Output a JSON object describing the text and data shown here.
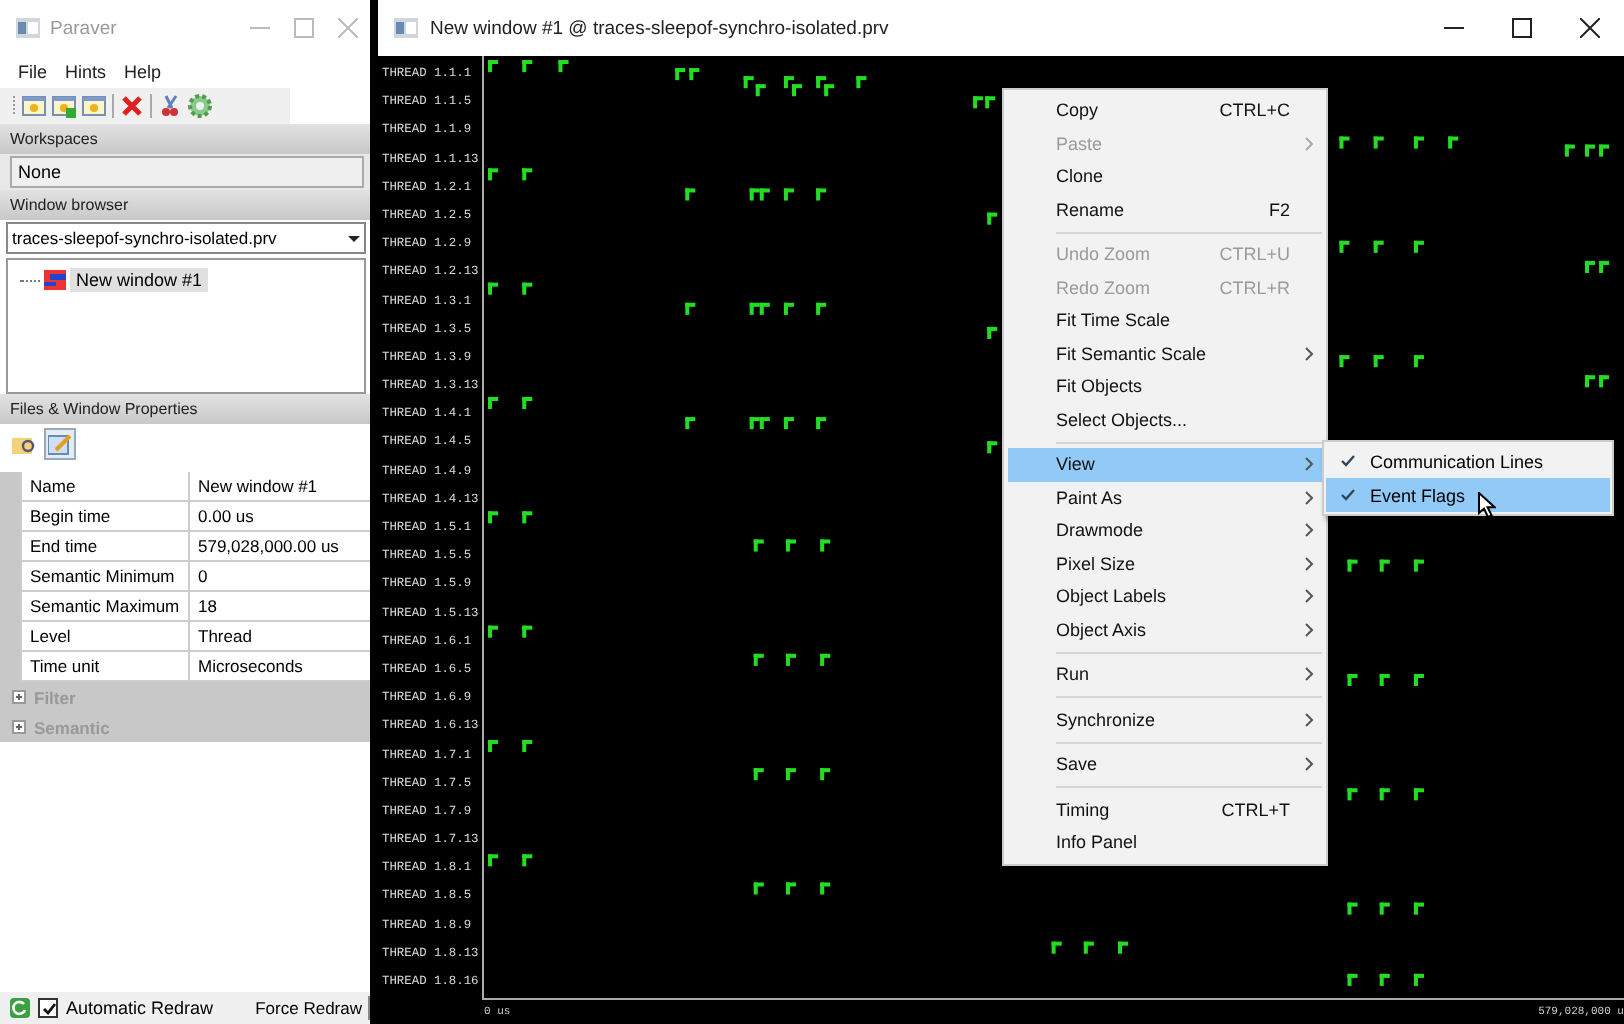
{
  "main_window": {
    "title": "Paraver",
    "menu": [
      "File",
      "Hints",
      "Help"
    ]
  },
  "workspaces": {
    "header": "Workspaces",
    "value": "None"
  },
  "window_browser": {
    "header": "Window browser",
    "trace": "traces-sleepof-synchro-isolated.prv",
    "tree": [
      {
        "label": "New window #1",
        "selected": true
      }
    ]
  },
  "properties": {
    "header": "Files & Window Properties",
    "icon_tabs": [
      {
        "selected": false
      },
      {
        "selected": true
      }
    ],
    "rows": [
      {
        "name": "Name",
        "value": "New window #1"
      },
      {
        "name": "Begin time",
        "value": "0.00 us"
      },
      {
        "name": "End time",
        "value": "579,028,000.00 us"
      },
      {
        "name": "Semantic Minimum",
        "value": "0"
      },
      {
        "name": "Semantic Maximum",
        "value": "18"
      },
      {
        "name": "Level",
        "value": "Thread"
      },
      {
        "name": "Time unit",
        "value": "Microseconds"
      }
    ],
    "groups": [
      {
        "label": "Filter",
        "expanded": false
      },
      {
        "label": "Semantic",
        "expanded": false
      }
    ]
  },
  "bottom_bar": {
    "automatic_redraw": {
      "label": "Automatic Redraw",
      "checked": true
    },
    "force_redraw": "Force Redraw"
  },
  "trace_window": {
    "title": "New window #1 @ traces-sleepof-synchro-isolated.prv",
    "threads": [
      "THREAD 1.1.1",
      "THREAD 1.1.5",
      "THREAD 1.1.9",
      "THREAD 1.1.13",
      "THREAD 1.2.1",
      "THREAD 1.2.5",
      "THREAD 1.2.9",
      "THREAD 1.2.13",
      "THREAD 1.3.1",
      "THREAD 1.3.5",
      "THREAD 1.3.9",
      "THREAD 1.3.13",
      "THREAD 1.4.1",
      "THREAD 1.4.5",
      "THREAD 1.4.9",
      "THREAD 1.4.13",
      "THREAD 1.5.1",
      "THREAD 1.5.5",
      "THREAD 1.5.9",
      "THREAD 1.5.13",
      "THREAD 1.6.1",
      "THREAD 1.6.5",
      "THREAD 1.6.9",
      "THREAD 1.6.13",
      "THREAD 1.7.1",
      "THREAD 1.7.5",
      "THREAD 1.7.9",
      "THREAD 1.7.13",
      "THREAD 1.8.1",
      "THREAD 1.8.5",
      "THREAD 1.8.9",
      "THREAD 1.8.13",
      "THREAD 1.8.16"
    ],
    "axis": {
      "start": "0 us",
      "end": "579,028,000 u"
    }
  },
  "context_menu": {
    "items": [
      {
        "kind": "item",
        "label": "Copy",
        "shortcut": "CTRL+C",
        "disabled": false,
        "submenu": false,
        "highlighted": false
      },
      {
        "kind": "item",
        "label": "Paste",
        "disabled": true,
        "submenu": true,
        "highlighted": false
      },
      {
        "kind": "item",
        "label": "Clone",
        "disabled": false,
        "submenu": false,
        "highlighted": false
      },
      {
        "kind": "item",
        "label": "Rename",
        "shortcut": "F2",
        "disabled": false,
        "submenu": false,
        "highlighted": false
      },
      {
        "kind": "separator"
      },
      {
        "kind": "item",
        "label": "Undo Zoom",
        "shortcut": "CTRL+U",
        "disabled": true,
        "submenu": false,
        "highlighted": false
      },
      {
        "kind": "item",
        "label": "Redo Zoom",
        "shortcut": "CTRL+R",
        "disabled": true,
        "submenu": false,
        "highlighted": false
      },
      {
        "kind": "item",
        "label": "Fit Time Scale",
        "disabled": false,
        "submenu": false,
        "highlighted": false
      },
      {
        "kind": "item",
        "label": "Fit Semantic Scale",
        "disabled": false,
        "submenu": true,
        "highlighted": false
      },
      {
        "kind": "item",
        "label": "Fit Objects",
        "disabled": false,
        "submenu": false,
        "highlighted": false
      },
      {
        "kind": "item",
        "label": "Select Objects...",
        "disabled": false,
        "submenu": false,
        "highlighted": false
      },
      {
        "kind": "separator"
      },
      {
        "kind": "item",
        "label": "View",
        "disabled": false,
        "submenu": true,
        "highlighted": true
      },
      {
        "kind": "item",
        "label": "Paint As",
        "disabled": false,
        "submenu": true,
        "highlighted": false
      },
      {
        "kind": "item",
        "label": "Drawmode",
        "disabled": false,
        "submenu": true,
        "highlighted": false
      },
      {
        "kind": "item",
        "label": "Pixel Size",
        "disabled": false,
        "submenu": true,
        "highlighted": false
      },
      {
        "kind": "item",
        "label": "Object Labels",
        "disabled": false,
        "submenu": true,
        "highlighted": false
      },
      {
        "kind": "item",
        "label": "Object Axis",
        "disabled": false,
        "submenu": true,
        "highlighted": false
      },
      {
        "kind": "separator"
      },
      {
        "kind": "item",
        "label": "Run",
        "disabled": false,
        "submenu": true,
        "highlighted": false
      },
      {
        "kind": "separator"
      },
      {
        "kind": "item",
        "label": "Synchronize",
        "disabled": false,
        "submenu": true,
        "highlighted": false
      },
      {
        "kind": "separator"
      },
      {
        "kind": "item",
        "label": "Save",
        "disabled": false,
        "submenu": true,
        "highlighted": false
      },
      {
        "kind": "separator"
      },
      {
        "kind": "item",
        "label": "Timing",
        "shortcut": "CTRL+T",
        "disabled": false,
        "submenu": false,
        "highlighted": false
      },
      {
        "kind": "item",
        "label": "Info Panel",
        "disabled": false,
        "submenu": false,
        "highlighted": false
      }
    ]
  },
  "submenu": {
    "items": [
      {
        "label": "Communication Lines",
        "checked": true,
        "highlighted": false
      },
      {
        "label": "Event Flags",
        "checked": true,
        "highlighted": true
      }
    ]
  }
}
